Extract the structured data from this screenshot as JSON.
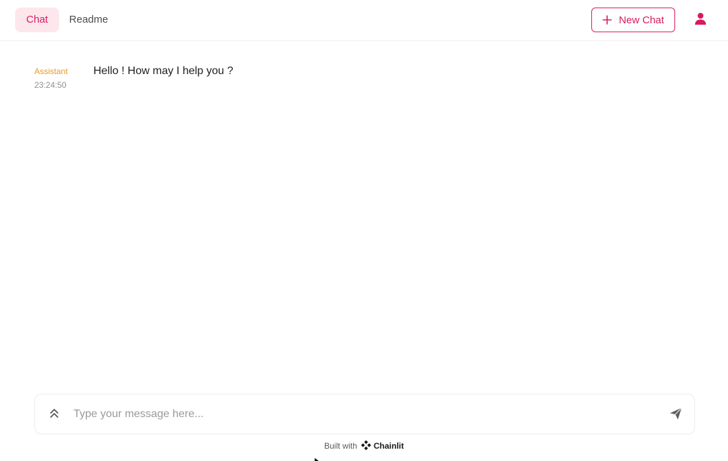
{
  "header": {
    "tabs": [
      {
        "label": "Chat",
        "active": true
      },
      {
        "label": "Readme",
        "active": false
      }
    ],
    "new_chat_label": "New Chat",
    "user_icon": "user-icon"
  },
  "messages": [
    {
      "author": "Assistant",
      "time": "23:24:50",
      "content": "Hello ! How may I help you ?"
    }
  ],
  "composer": {
    "value": "",
    "placeholder": "Type your message here...",
    "expand_icon": "chevrons-up-icon",
    "send_icon": "send-icon"
  },
  "footer": {
    "built_with": "Built with",
    "brand": "Chainlit"
  },
  "colors": {
    "accent": "#d81b60",
    "active_tab_bg": "#fde6ec",
    "author": "#e39a2d",
    "timestamp": "#8f8f8f"
  }
}
